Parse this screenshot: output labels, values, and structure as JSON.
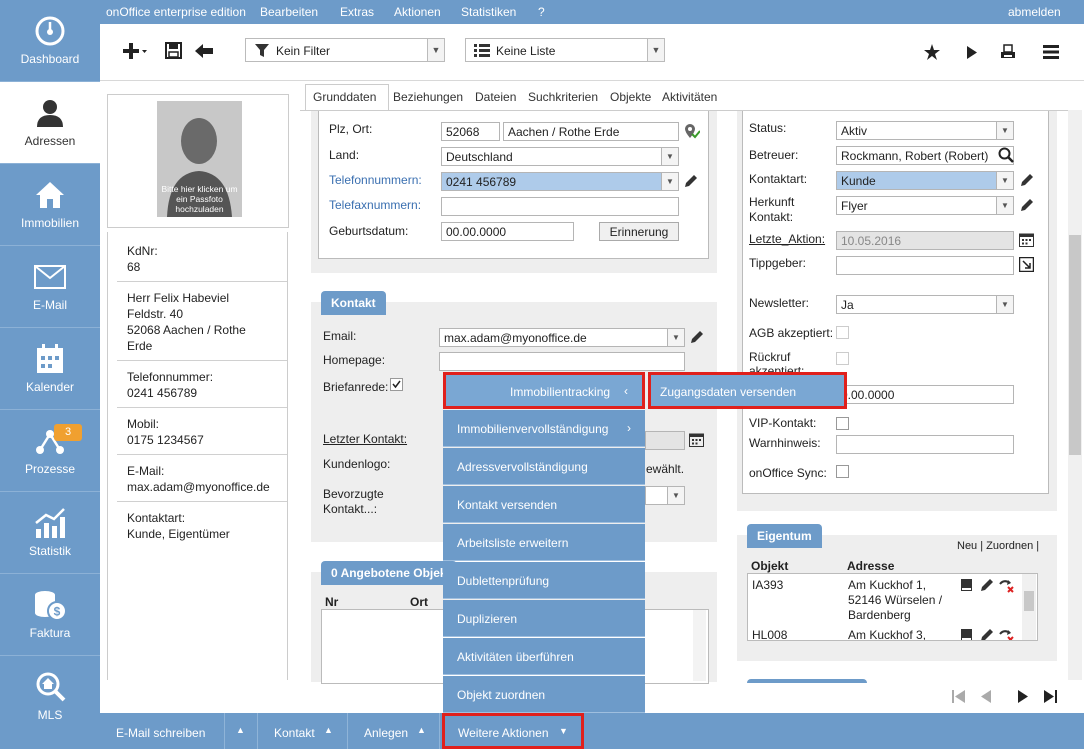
{
  "topbar": {
    "edition": "onOffice enterprise edition",
    "menu": [
      "Bearbeiten",
      "Extras",
      "Aktionen",
      "Statistiken",
      "?"
    ],
    "logout": "abmelden"
  },
  "nav": [
    {
      "label": "Dashboard",
      "icon": "dashboard-icon"
    },
    {
      "label": "Adressen",
      "icon": "person-icon"
    },
    {
      "label": "Immobilien",
      "icon": "house-icon"
    },
    {
      "label": "E-Mail",
      "icon": "envelope-icon"
    },
    {
      "label": "Kalender",
      "icon": "calendar-icon"
    },
    {
      "label": "Prozesse",
      "icon": "process-icon",
      "badge": "3"
    },
    {
      "label": "Statistik",
      "icon": "chart-icon"
    },
    {
      "label": "Faktura",
      "icon": "coins-icon"
    },
    {
      "label": "MLS",
      "icon": "mls-icon"
    }
  ],
  "toolbar": {
    "filter": "Kein Filter",
    "list": "Keine Liste"
  },
  "photo_hint": "Bitte hier klicken um ein Passfoto hochzuladen",
  "info": {
    "kdnr_label": "KdNr:",
    "kdnr": "68",
    "name": "Herr Felix Habeviel",
    "street": "Feldstr. 40",
    "city1": "52068 Aachen / Rothe",
    "city2": "Erde",
    "tel_label": "Telefonnummer:",
    "tel": "0241 456789",
    "mobil_label": "Mobil:",
    "mobil": "0175 1234567",
    "email_label": "E-Mail:",
    "email": "max.adam@myonoffice.de",
    "kontaktart_label": "Kontaktart:",
    "kontaktart": "Kunde, Eigentümer"
  },
  "tabs": [
    "Grunddaten",
    "Beziehungen",
    "Dateien",
    "Suchkriterien",
    "Objekte",
    "Aktivitäten"
  ],
  "form": {
    "plz_label": "Plz, Ort:",
    "plz": "52068",
    "ort": "Aachen / Rothe Erde",
    "land_label": "Land:",
    "land": "Deutschland",
    "tel_label": "Telefonnummern:",
    "tel": "0241 456789",
    "fax_label": "Telefaxnummern:",
    "geb_label": "Geburtsdatum:",
    "geb": "00.00.0000",
    "erinnerung": "Erinnerung"
  },
  "kontakt": {
    "title": "Kontakt",
    "email_label": "Email:",
    "email": "max.adam@myonoffice.de",
    "homepage_label": "Homepage:",
    "briefanrede_label": "Briefanrede:",
    "letzter_label": "Letzter Kontakt:",
    "logo_label": "Kundenlogo:",
    "logo_hint": "ewählt.",
    "bevorzugt_label1": "Bevorzugte",
    "bevorzugt_label2": "Kontakt...:"
  },
  "angebote": {
    "title": "0 Angebotene Objek",
    "col_nr": "Nr",
    "col_ort": "Ort"
  },
  "right": {
    "status_label": "Status:",
    "status": "Aktiv",
    "betreuer_label": "Betreuer:",
    "betreuer": "Rockmann, Robert (Robert)",
    "kontaktart_label": "Kontaktart:",
    "kontaktart": "Kunde",
    "herkunft_label1": "Herkunft",
    "herkunft_label2": "Kontakt:",
    "herkunft": "Flyer",
    "letzte_label": "Letzte_Aktion:",
    "letzte": "10.05.2016",
    "tipp_label": "Tippgeber:",
    "newsletter_label": "Newsletter:",
    "newsletter": "Ja",
    "agb_label": "AGB akzeptiert:",
    "rueckruf_label": "Rückruf",
    "rueckruf_label2": "akzeptiert:",
    "datum": "0.00.0000",
    "vip_label": "VIP-Kontakt:",
    "warn_label": "Warnhinweis:",
    "sync_label": "onOffice Sync:"
  },
  "eigentum": {
    "title": "Eigentum",
    "links": "Neu | Zuordnen |",
    "col_objekt": "Objekt",
    "col_adresse": "Adresse",
    "rows": [
      {
        "objekt": "IA393",
        "adresse1": "Am Kuckhof 1,",
        "adresse2": "52146 Würselen /",
        "adresse3": "Bardenberg"
      },
      {
        "objekt": "HL008",
        "adresse1": "Am Kuckhof 3,",
        "adresse2": "",
        "adresse3": ""
      }
    ]
  },
  "menu": {
    "items": [
      "Immobilientracking",
      "Immobilienvervollständigung",
      "Adressvervollständigung",
      "Kontakt versenden",
      "Arbeitsliste erweitern",
      "Dublettenprüfung",
      "Duplizieren",
      "Aktivitäten überführen",
      "Objekt zuordnen"
    ],
    "submenu": "Zugangsdaten versenden"
  },
  "bottom": {
    "email": "E-Mail schreiben",
    "kontakt": "Kontakt",
    "anlegen": "Anlegen",
    "weitere": "Weitere Aktionen"
  },
  "colors": {
    "nav": "#6d9bc9",
    "highlight": "#e0201c",
    "selected": "#aecbea"
  }
}
